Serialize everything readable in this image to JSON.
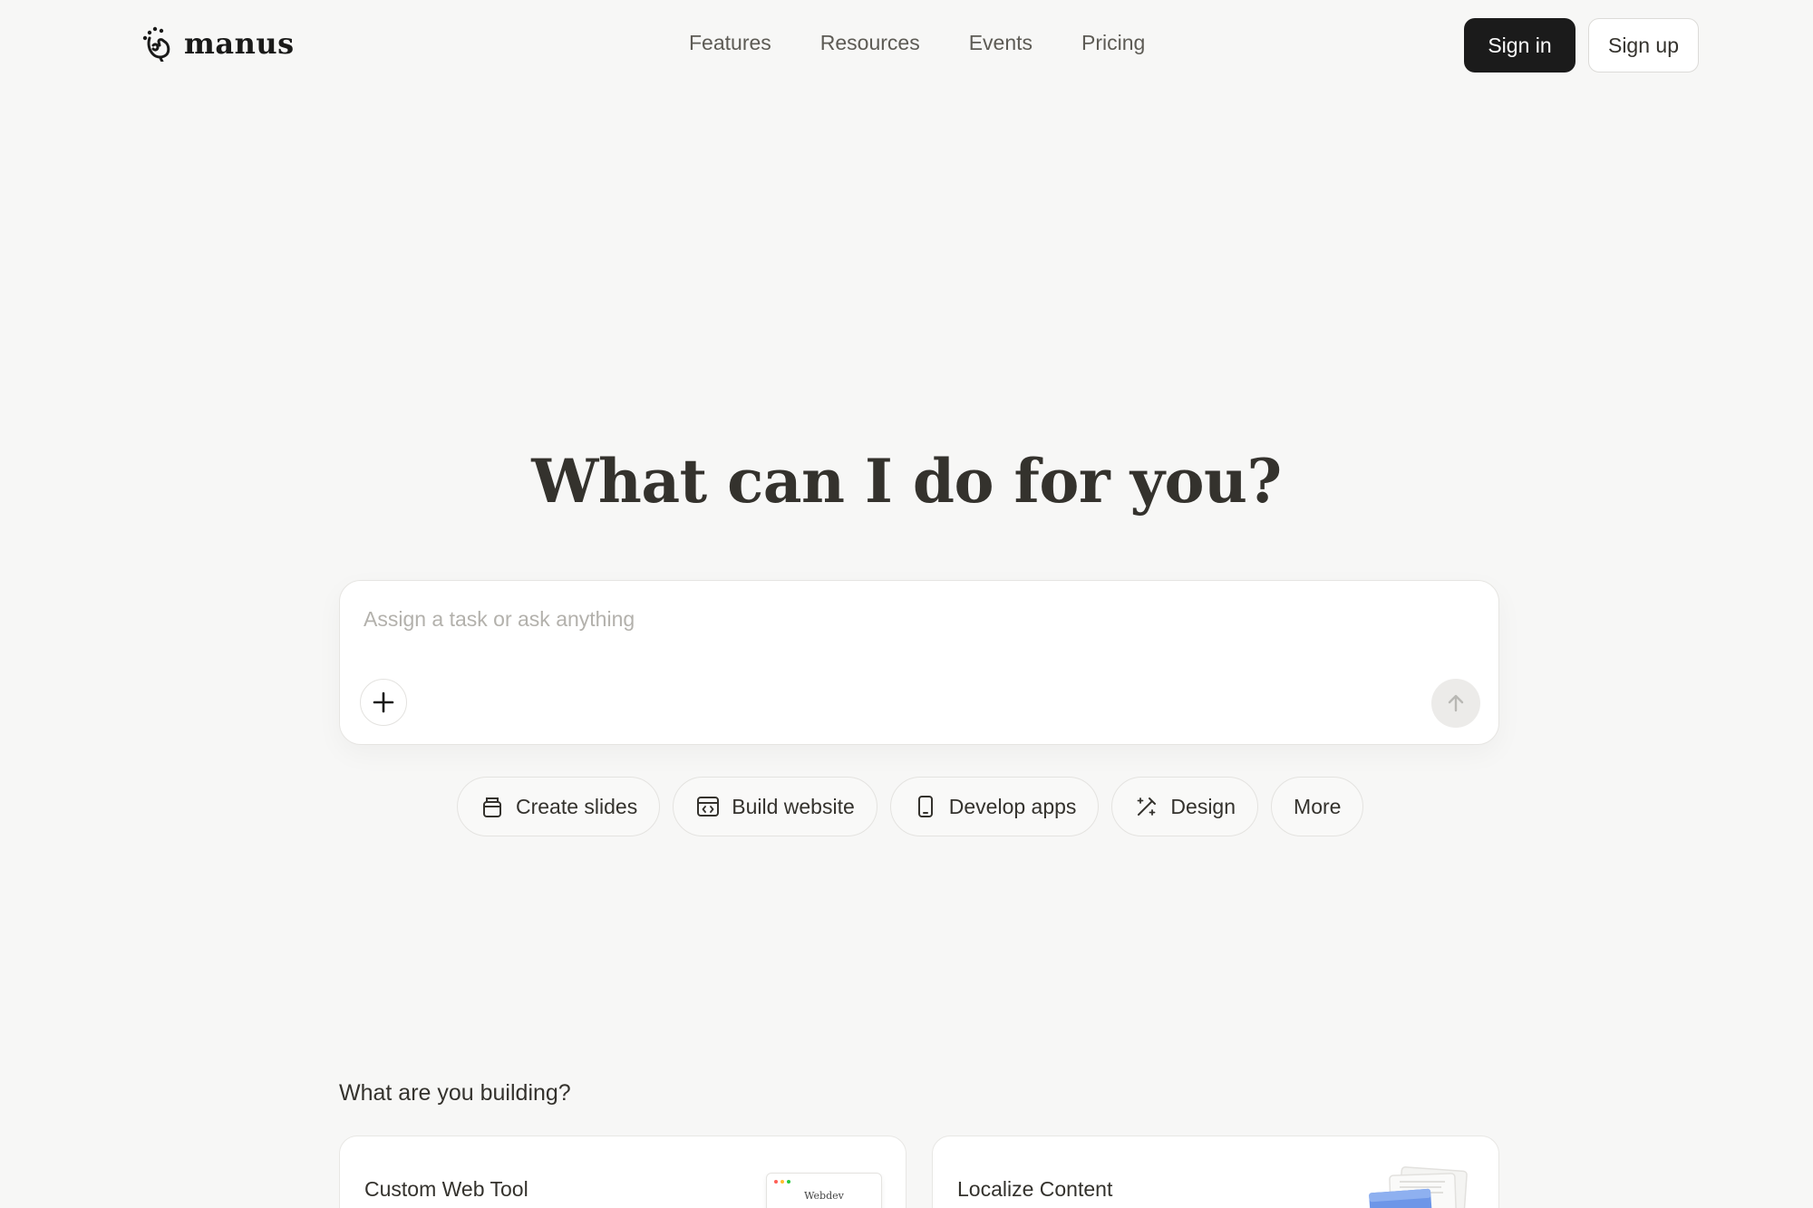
{
  "brand": {
    "name": "manus"
  },
  "nav": {
    "items": [
      {
        "label": "Features"
      },
      {
        "label": "Resources"
      },
      {
        "label": "Events"
      },
      {
        "label": "Pricing"
      }
    ]
  },
  "auth": {
    "sign_in": "Sign in",
    "sign_up": "Sign up"
  },
  "hero": {
    "title": "What can I do for you?"
  },
  "composer": {
    "placeholder": "Assign a task or ask anything",
    "value": ""
  },
  "quick_actions": [
    {
      "label": "Create slides",
      "icon": "slides-icon"
    },
    {
      "label": "Build website",
      "icon": "website-icon"
    },
    {
      "label": "Develop apps",
      "icon": "phone-icon"
    },
    {
      "label": "Design",
      "icon": "design-icon"
    },
    {
      "label": "More"
    }
  ],
  "building": {
    "title": "What are you building?",
    "cards": [
      {
        "label": "Custom Web Tool",
        "thumb_text": "Webdev"
      },
      {
        "label": "Localize Content"
      }
    ]
  },
  "colors": {
    "background": "#f7f7f6",
    "primary_button": "#1b1b1b",
    "text": "#34322d",
    "muted_text": "#5d5b55",
    "placeholder": "#b3b1ac"
  }
}
